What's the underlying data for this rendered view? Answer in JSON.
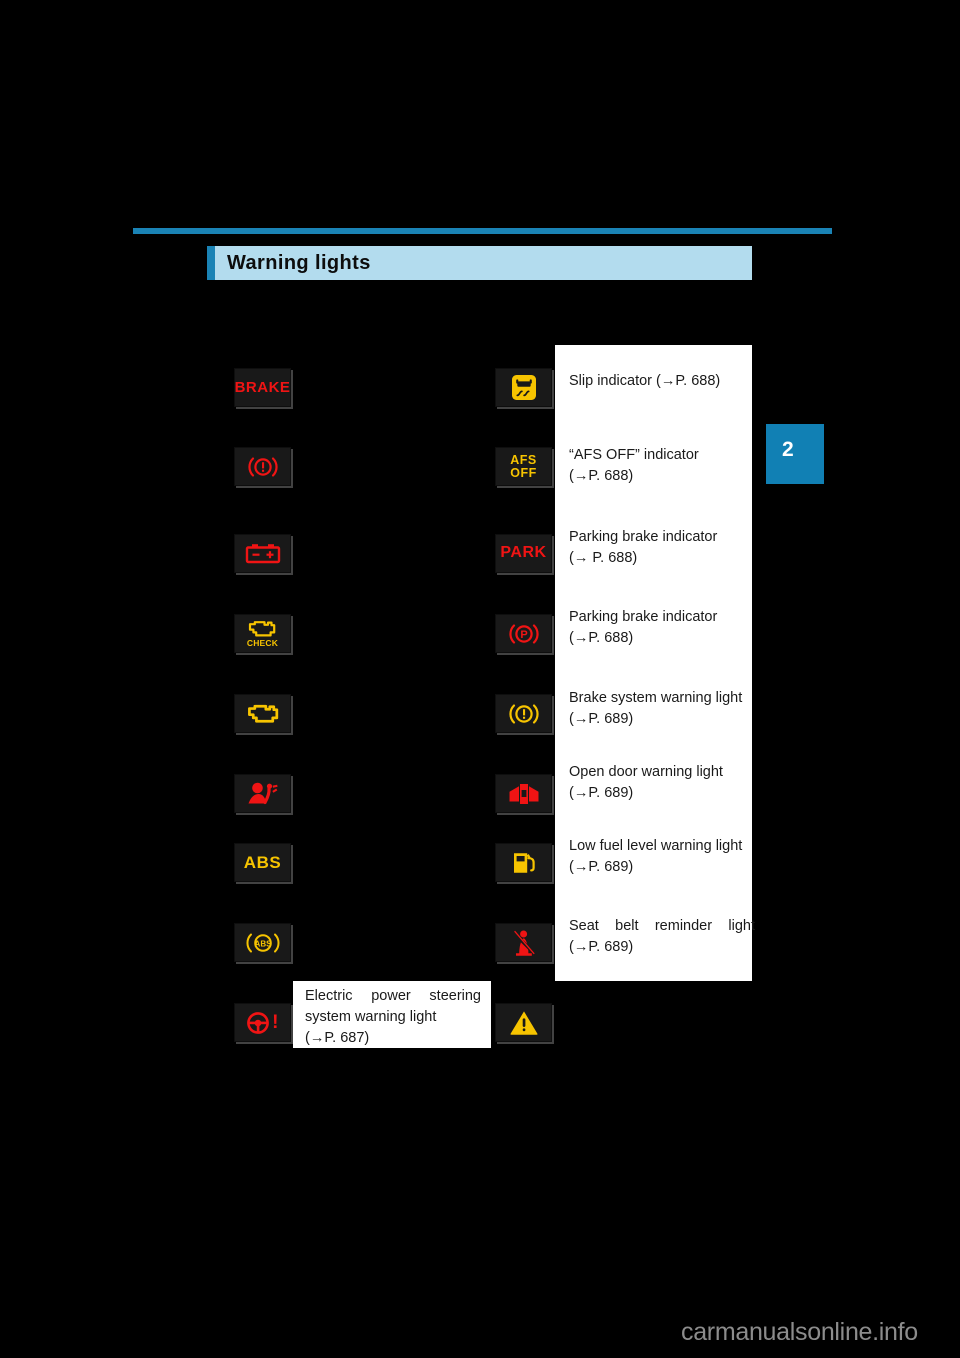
{
  "page": {
    "chapter_tab": "2",
    "watermark": "carmanualsonline.info"
  },
  "section": {
    "title": "Warning lights"
  },
  "left_column": [
    {
      "icon_name": "brake-text-warning-icon",
      "icon_text": "BRAKE",
      "color": "#f01414"
    },
    {
      "icon_name": "brake-system-warning-red-icon",
      "icon_text": "",
      "color": "#f01414"
    },
    {
      "icon_name": "charging-system-warning-icon",
      "icon_text": "",
      "color": "#f01414"
    },
    {
      "icon_name": "check-engine-check-icon",
      "icon_text": "CHECK",
      "color": "#f7c400"
    },
    {
      "icon_name": "malfunction-indicator-icon",
      "icon_text": "",
      "color": "#f7c400"
    },
    {
      "icon_name": "srs-airbag-warning-icon",
      "icon_text": "",
      "color": "#f01414"
    },
    {
      "icon_name": "abs-text-warning-icon",
      "icon_text": "ABS",
      "color": "#f7c400"
    },
    {
      "icon_name": "abs-ring-warning-icon",
      "icon_text": "ABS",
      "color": "#f7c400"
    },
    {
      "icon_name": "electric-power-steering-icon",
      "icon_text": "!",
      "color": "#f01414"
    }
  ],
  "left_caption": {
    "line1": "Electric power steering",
    "line2": "system warning light",
    "line3": "(→P. 687)"
  },
  "right_column": [
    {
      "icon_name": "slip-indicator-icon",
      "icon_text": "",
      "color": "#f7c400",
      "label_line1": "Slip indicator (→P. 688)",
      "label_line2": "",
      "justify": false
    },
    {
      "icon_name": "afs-off-indicator-icon",
      "icon_text": "AFS\nOFF",
      "color": "#f7c400",
      "label_line1": "“AFS OFF” indicator",
      "label_line2": "(→P. 688)",
      "justify": false
    },
    {
      "icon_name": "park-text-indicator-icon",
      "icon_text": "PARK",
      "color": "#f01414",
      "label_line1": "Parking brake indicator",
      "label_line2": "(→ P. 688)",
      "justify": false
    },
    {
      "icon_name": "parking-brake-ring-indicator-icon",
      "icon_text": "",
      "color": "#f01414",
      "label_line1": "Parking brake indicator",
      "label_line2": "(→P. 688)",
      "justify": false
    },
    {
      "icon_name": "brake-system-warning-amber-icon",
      "icon_text": "",
      "color": "#f7c400",
      "label_line1": "Brake system warning light",
      "label_line2": "(→P. 689)",
      "justify": false
    },
    {
      "icon_name": "open-door-warning-icon",
      "icon_text": "",
      "color": "#f01414",
      "label_line1": "Open door warning light",
      "label_line2": "(→P. 689)",
      "justify": false
    },
    {
      "icon_name": "low-fuel-level-warning-icon",
      "icon_text": "",
      "color": "#f7c400",
      "label_line1": "Low fuel level warning light",
      "label_line2": "(→P. 689)",
      "justify": false
    },
    {
      "icon_name": "seat-belt-reminder-icon",
      "icon_text": "",
      "color": "#f01414",
      "label_line1": "Seat belt reminder light",
      "label_line2": "(→P. 689)",
      "justify": true
    },
    {
      "icon_name": "master-warning-triangle-icon",
      "icon_text": "",
      "color": "#f7c400",
      "label_line1": "",
      "label_line2": "",
      "justify": false
    }
  ]
}
